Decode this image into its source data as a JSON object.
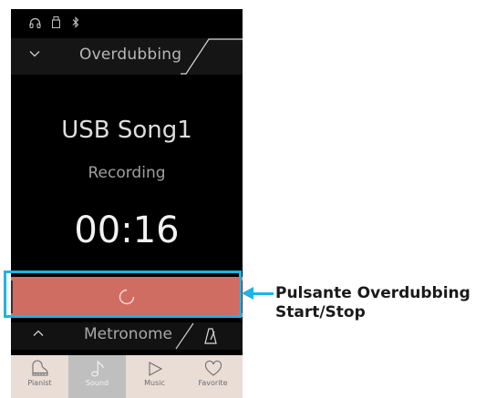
{
  "header": {
    "title": "Overdubbing"
  },
  "song": {
    "name": "USB Song1",
    "status": "Recording",
    "time": "00:16"
  },
  "record_button": {
    "state": "in-progress"
  },
  "metronome": {
    "label": "Metronome"
  },
  "tabs": [
    {
      "label": "Pianist",
      "icon": "piano-icon"
    },
    {
      "label": "Sound",
      "icon": "note-icon",
      "active": true
    },
    {
      "label": "Music",
      "icon": "play-icon"
    },
    {
      "label": "Favorite",
      "icon": "heart-icon"
    }
  ],
  "callout": {
    "line1": "Pulsante Overdubbing",
    "line2": "Start/Stop"
  },
  "colors": {
    "record": "#d06d63",
    "highlight": "#1fb3e6",
    "tabbar": "#e9ddd6"
  }
}
